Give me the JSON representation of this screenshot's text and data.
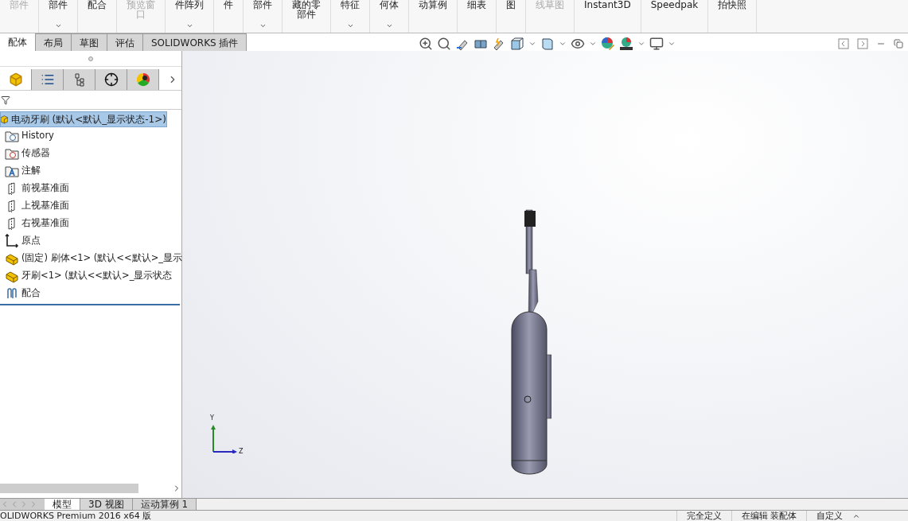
{
  "ribbon": {
    "items": [
      {
        "lines": [
          "部件"
        ],
        "disabled": true,
        "dropdown": false
      },
      {
        "lines": [
          "部件"
        ],
        "disabled": false,
        "dropdown": true
      },
      {
        "lines": [
          "配合"
        ],
        "disabled": false,
        "dropdown": false
      },
      {
        "lines": [
          "预览窗",
          "口"
        ],
        "disabled": true,
        "dropdown": false
      },
      {
        "lines": [
          "件阵列"
        ],
        "disabled": false,
        "dropdown": true
      },
      {
        "lines": [
          "件"
        ],
        "disabled": false,
        "dropdown": false
      },
      {
        "lines": [
          "部件"
        ],
        "disabled": false,
        "dropdown": true
      },
      {
        "lines": [
          "藏的零",
          "部件"
        ],
        "disabled": false,
        "dropdown": false
      },
      {
        "lines": [
          "特征"
        ],
        "disabled": false,
        "dropdown": true
      },
      {
        "lines": [
          "何体"
        ],
        "disabled": false,
        "dropdown": true
      },
      {
        "lines": [
          "动算例"
        ],
        "disabled": false,
        "dropdown": false
      },
      {
        "lines": [
          "细表"
        ],
        "disabled": false,
        "dropdown": false
      },
      {
        "lines": [
          "图"
        ],
        "disabled": false,
        "dropdown": false
      },
      {
        "lines": [
          "线草图"
        ],
        "disabled": true,
        "dropdown": false
      },
      {
        "lines": [
          "Instant3D"
        ],
        "disabled": false,
        "dropdown": false
      },
      {
        "lines": [
          "Speedpak"
        ],
        "disabled": false,
        "dropdown": false
      },
      {
        "lines": [
          "拍快照"
        ],
        "disabled": false,
        "dropdown": false
      }
    ]
  },
  "command_tabs": [
    {
      "label": "配体",
      "selected": true
    },
    {
      "label": "布局",
      "selected": false
    },
    {
      "label": "草图",
      "selected": false
    },
    {
      "label": "评估",
      "selected": false
    },
    {
      "label": "SOLIDWORKS 插件",
      "selected": false
    }
  ],
  "manager_tabs": [
    {
      "kind": "feature",
      "selected": true
    },
    {
      "kind": "property",
      "selected": false
    },
    {
      "kind": "config",
      "selected": false
    },
    {
      "kind": "dimxpert",
      "selected": false
    },
    {
      "kind": "display",
      "selected": false
    }
  ],
  "tree": {
    "root": {
      "label": "电动牙刷  (默认<默认_显示状态-1>)",
      "selected": true
    },
    "children": [
      {
        "kind": "history",
        "label": "History"
      },
      {
        "kind": "sensor",
        "label": "传感器"
      },
      {
        "kind": "annotation",
        "label": "注解"
      },
      {
        "kind": "plane",
        "label": "前视基准面"
      },
      {
        "kind": "plane",
        "label": "上视基准面"
      },
      {
        "kind": "plane",
        "label": "右视基准面"
      },
      {
        "kind": "origin",
        "label": "原点"
      },
      {
        "kind": "part",
        "label": "(固定) 刷体<1> (默认<<默认>_显示"
      },
      {
        "kind": "part",
        "label": "牙刷<1> (默认<<默认>_显示状态"
      },
      {
        "kind": "mates",
        "label": "配合"
      }
    ]
  },
  "triad": {
    "y_label": "Y",
    "z_label": "Z"
  },
  "bottom_tabs": [
    {
      "label": "模型",
      "selected": true
    },
    {
      "label": "3D 视图",
      "selected": false
    },
    {
      "label": "运动算例 1",
      "selected": false
    }
  ],
  "status_bar": {
    "app": "OLIDWORKS Premium 2016 x64 版",
    "fields": [
      "完全定义",
      "在编辑 装配体",
      "自定义"
    ]
  }
}
